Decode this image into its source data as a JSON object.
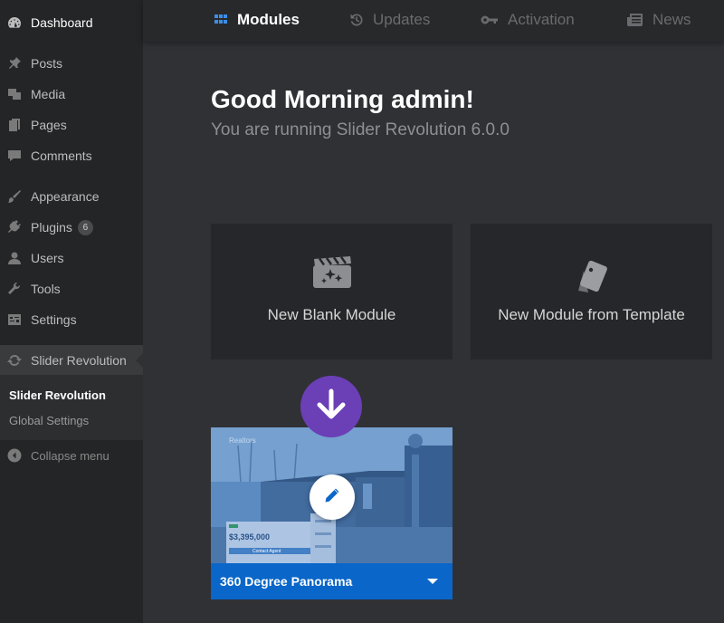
{
  "sidebar": {
    "items": [
      {
        "label": "Dashboard",
        "icon": "dashboard-icon"
      },
      {
        "label": "Posts",
        "icon": "pin-icon"
      },
      {
        "label": "Media",
        "icon": "media-icon"
      },
      {
        "label": "Pages",
        "icon": "pages-icon"
      },
      {
        "label": "Comments",
        "icon": "comment-icon"
      },
      {
        "label": "Appearance",
        "icon": "brush-icon"
      },
      {
        "label": "Plugins",
        "icon": "plug-icon",
        "badge": "6"
      },
      {
        "label": "Users",
        "icon": "user-icon"
      },
      {
        "label": "Tools",
        "icon": "wrench-icon"
      },
      {
        "label": "Settings",
        "icon": "settings-icon"
      },
      {
        "label": "Slider Revolution",
        "icon": "refresh-icon"
      }
    ],
    "submenu": [
      {
        "label": "Slider Revolution"
      },
      {
        "label": "Global Settings"
      }
    ],
    "collapse_label": "Collapse menu"
  },
  "topnav": {
    "tabs": [
      {
        "label": "Modules",
        "icon": "grid-icon"
      },
      {
        "label": "Updates",
        "icon": "refresh-icon"
      },
      {
        "label": "Activation",
        "icon": "key-icon"
      },
      {
        "label": "News",
        "icon": "newspaper-icon"
      }
    ]
  },
  "main": {
    "greeting": "Good Morning admin!",
    "subtitle": "You are running Slider Revolution 6.0.0",
    "cards": [
      {
        "label": "New Blank Module",
        "icon": "clapperboard-icon"
      },
      {
        "label": "New Module from Template",
        "icon": "template-cards-icon"
      }
    ],
    "module": {
      "title": "360 Degree Panorama",
      "thumb_text": {
        "brand": "Realtors",
        "price": "$3,395,000",
        "cta": "Contact Agent"
      }
    }
  },
  "colors": {
    "sidebar_bg": "#242526",
    "main_bg": "#303135",
    "accent_blue": "#0a66c8",
    "download_purple": "#6b3fb6"
  }
}
